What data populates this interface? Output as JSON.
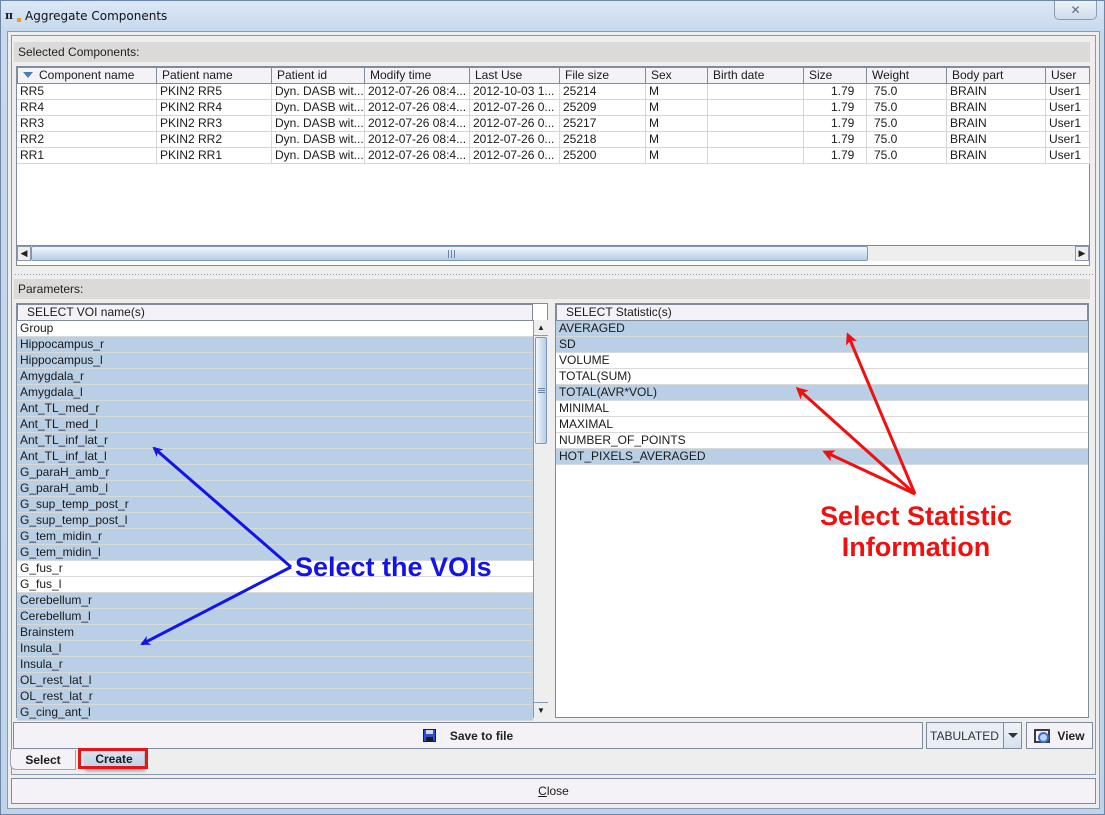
{
  "window": {
    "title": "Aggregate Components",
    "app_icon": "pmod-logo-icon",
    "close_icon": "close-icon"
  },
  "components": {
    "label": "Selected Components:",
    "sort_icon": "sort-descending-icon",
    "columns": [
      "Component name",
      "Patient name",
      "Patient id",
      "Modify time",
      "Last Use",
      "File size",
      "Sex",
      "Birth date",
      "Size",
      "Weight",
      "Body part",
      "User"
    ],
    "rows": [
      [
        "RR5",
        "PKIN2 RR5",
        "Dyn. DASB wit...",
        "2012-07-26 08:4...",
        "2012-10-03 1...",
        "25214",
        "M",
        "",
        "1.79",
        "75.0",
        "BRAIN",
        "User1"
      ],
      [
        "RR4",
        "PKIN2 RR4",
        "Dyn. DASB wit...",
        "2012-07-26 08:4...",
        "2012-07-26 0...",
        "25209",
        "M",
        "",
        "1.79",
        "75.0",
        "BRAIN",
        "User1"
      ],
      [
        "RR3",
        "PKIN2 RR3",
        "Dyn. DASB wit...",
        "2012-07-26 08:4...",
        "2012-07-26 0...",
        "25217",
        "M",
        "",
        "1.79",
        "75.0",
        "BRAIN",
        "User1"
      ],
      [
        "RR2",
        "PKIN2 RR2",
        "Dyn. DASB wit...",
        "2012-07-26 08:4...",
        "2012-07-26 0...",
        "25218",
        "M",
        "",
        "1.79",
        "75.0",
        "BRAIN",
        "User1"
      ],
      [
        "RR1",
        "PKIN2 RR1",
        "Dyn. DASB wit...",
        "2012-07-26 08:4...",
        "2012-07-26 0...",
        "25200",
        "M",
        "",
        "1.79",
        "75.0",
        "BRAIN",
        "User1"
      ]
    ]
  },
  "parameters": {
    "label": "Parameters:",
    "voi_header": "SELECT VOI name(s)",
    "vois": [
      {
        "name": "Group",
        "selected": false
      },
      {
        "name": "Hippocampus_r",
        "selected": true
      },
      {
        "name": "Hippocampus_l",
        "selected": true
      },
      {
        "name": "Amygdala_r",
        "selected": true
      },
      {
        "name": "Amygdala_l",
        "selected": true
      },
      {
        "name": "Ant_TL_med_r",
        "selected": true
      },
      {
        "name": "Ant_TL_med_l",
        "selected": true
      },
      {
        "name": "Ant_TL_inf_lat_r",
        "selected": true
      },
      {
        "name": "Ant_TL_inf_lat_l",
        "selected": true
      },
      {
        "name": "G_paraH_amb_r",
        "selected": true
      },
      {
        "name": "G_paraH_amb_l",
        "selected": true
      },
      {
        "name": "G_sup_temp_post_r",
        "selected": true
      },
      {
        "name": "G_sup_temp_post_l",
        "selected": true
      },
      {
        "name": "G_tem_midin_r",
        "selected": true
      },
      {
        "name": "G_tem_midin_l",
        "selected": true
      },
      {
        "name": "G_fus_r",
        "selected": false
      },
      {
        "name": "G_fus_l",
        "selected": false
      },
      {
        "name": "Cerebellum_r",
        "selected": true
      },
      {
        "name": "Cerebellum_l",
        "selected": true
      },
      {
        "name": "Brainstem",
        "selected": true
      },
      {
        "name": "Insula_l",
        "selected": true
      },
      {
        "name": "Insula_r",
        "selected": true
      },
      {
        "name": "OL_rest_lat_l",
        "selected": true
      },
      {
        "name": "OL_rest_lat_r",
        "selected": true
      },
      {
        "name": "G_cing_ant_l",
        "selected": true
      }
    ],
    "stat_header": "SELECT Statistic(s)",
    "statistics": [
      {
        "name": "AVERAGED",
        "selected": true
      },
      {
        "name": "SD",
        "selected": true
      },
      {
        "name": "VOLUME",
        "selected": false
      },
      {
        "name": "TOTAL(SUM)",
        "selected": false
      },
      {
        "name": "TOTAL(AVR*VOL)",
        "selected": true
      },
      {
        "name": "MINIMAL",
        "selected": false
      },
      {
        "name": "MAXIMAL",
        "selected": false
      },
      {
        "name": "NUMBER_OF_POINTS",
        "selected": false
      },
      {
        "name": "HOT_PIXELS_AVERAGED",
        "selected": true
      }
    ]
  },
  "toolbar": {
    "save_label": "Save to file",
    "save_icon": "floppy-disk-icon",
    "format_value": "TABULATED",
    "view_label": "View",
    "view_icon": "zoom-view-icon"
  },
  "tabs": {
    "select_label": "Select",
    "create_label": "Create",
    "active": "Create"
  },
  "footer": {
    "close_mnemonic": "C",
    "close_rest": "lose"
  },
  "annotations": {
    "voi_callout": "Select the VOIs",
    "stat_callout_line1": "Select Statistic",
    "stat_callout_line2": "Information",
    "voi_color": "#1414e6",
    "stat_color": "#f01010",
    "highlight_color": "#e8141c"
  },
  "colors": {
    "selection": "#b8cfe5",
    "panel": "#eeeeee",
    "header": "#f5f2f7"
  }
}
